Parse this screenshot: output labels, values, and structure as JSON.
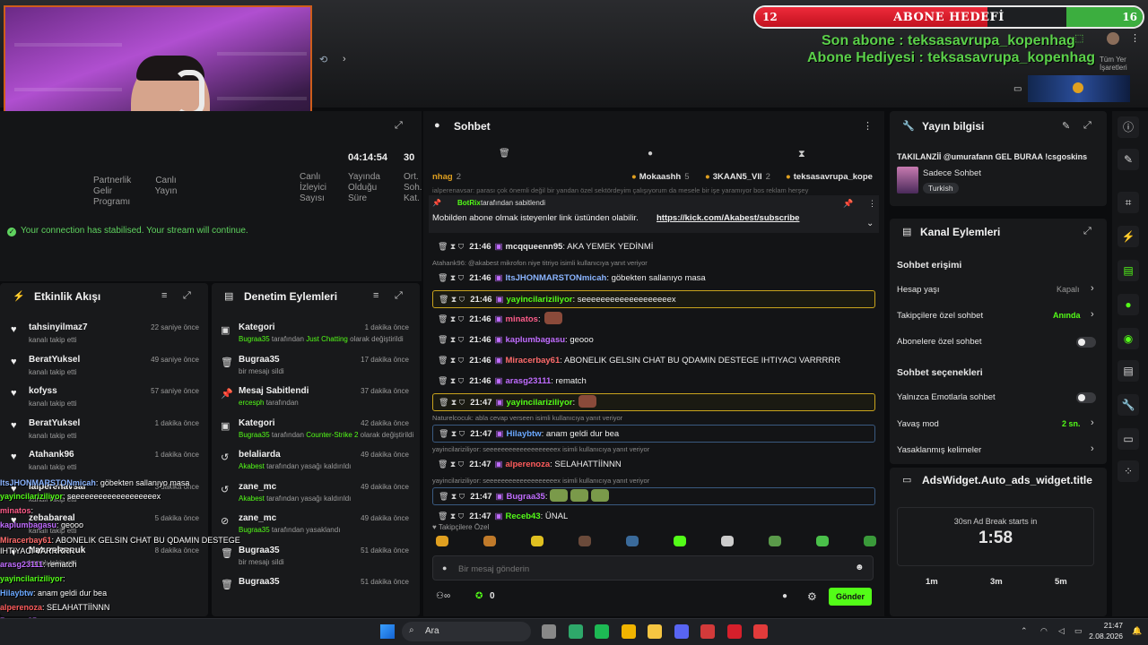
{
  "overlay": {
    "goal_title": "ABONE HEDEFİ",
    "goal_current": "12",
    "goal_target": "16",
    "goal_progress": 0.75,
    "last_sub": "Son abone : teksasavrupa_kopenhag",
    "gift_sub": "Abone Hediyesi : teksasavrupa_kopenhag",
    "bookmarks": "Tüm Yer İşaretleri",
    "chat_lines": [
      {
        "user": "ItsJHONMARSTONmicah",
        "text": ": göbekten sallanıyo masa"
      },
      {
        "user": "yayincilariziliyor",
        "text": ": seeeeeeeeeeeeeeeeeeex"
      },
      {
        "user": "minatos",
        "text": ":"
      },
      {
        "user": "kaplumbagasu",
        "text": ": geooo"
      },
      {
        "user": "Miracerbay61",
        "text": ": ABONELIK GELSIN CHAT BU QDAMIN DESTEGE IHTIYACI VARRRRR"
      },
      {
        "user": "arasg23111",
        "text": ": rematch"
      },
      {
        "user": "yayincilariziliyor",
        "text": ":"
      },
      {
        "user": "Hilaybtw",
        "text": ": anam geldi dur bea"
      },
      {
        "user": "alperenoza",
        "text": ": SELAHATTİİNNN"
      },
      {
        "user": "Bugraa35",
        "text": ":"
      },
      {
        "user": "Receb43",
        "text": ": ÜNAL"
      }
    ]
  },
  "stats": {
    "partner_label": "Partnerlik Gelir Programı",
    "live_label": "Canlı Yayın",
    "time_value": "04:14:54",
    "time_label": "Yayında Olduğu Süre",
    "extra_value": "30",
    "extra_label": "Ort. Soh. Kat.",
    "viewers_label": "Canlı İzleyici Sayısı",
    "connection": "Your connection has stabilised. Your stream will continue."
  },
  "activity": {
    "title": "Etkinlik Akışı",
    "items": [
      {
        "user": "tahsinyilmaz7",
        "sub": "kanalı takip etti",
        "time": "22 saniye önce"
      },
      {
        "user": "BeratYuksel",
        "sub": "kanalı takip etti",
        "time": "49 saniye önce"
      },
      {
        "user": "kofyss",
        "sub": "kanalı takip etti",
        "time": "57 saniye önce"
      },
      {
        "user": "BeratYuksel",
        "sub": "kanalı takip etti",
        "time": "1 dakika önce"
      },
      {
        "user": "Atahank96",
        "sub": "kanalı takip etti",
        "time": "1 dakika önce"
      },
      {
        "user": "ialperenavsar",
        "sub": "kanalı takip etti",
        "time": "3 dakika önce"
      },
      {
        "user": "zebabareal",
        "sub": "kanalı takip etti",
        "time": "5 dakika önce"
      },
      {
        "user": "Naturelcocuk",
        "sub": "kanalı takip etti",
        "time": "8 dakika önce"
      }
    ]
  },
  "moderation": {
    "title": "Denetim Eylemleri",
    "items": [
      {
        "title": "Kategori",
        "actor": "Bugraa35",
        "mid": " tarafından ",
        "target": "Just Chatting",
        "end": " olarak değiştirildi",
        "time": "1 dakika önce"
      },
      {
        "title": "Bugraa35",
        "actor": "",
        "mid": "bir mesajı sildi",
        "target": "",
        "end": "",
        "time": "17 dakika önce"
      },
      {
        "title": "Mesaj Sabitlendi",
        "actor": "ercesph",
        "mid": " tarafından",
        "target": "",
        "end": "",
        "time": "37 dakika önce"
      },
      {
        "title": "Kategori",
        "actor": "Bugraa35",
        "mid": " tarafından ",
        "target": "Counter-Strike 2",
        "end": " olarak değiştirildi",
        "time": "42 dakika önce"
      },
      {
        "title": "belaliarda",
        "actor": "Akabest",
        "mid": " tarafından yasağı kaldırıldı",
        "target": "",
        "end": "",
        "time": "49 dakika önce"
      },
      {
        "title": "zane_mc",
        "actor": "Akabest",
        "mid": " tarafından yasağı kaldırıldı",
        "target": "",
        "end": "",
        "time": "49 dakika önce"
      },
      {
        "title": "zane_mc",
        "actor": "Bugraa35",
        "mid": " tarafından yasaklandı",
        "target": "",
        "end": "",
        "time": "49 dakika önce"
      },
      {
        "title": "Bugraa35",
        "actor": "",
        "mid": "bir mesajı sildi",
        "target": "",
        "end": "",
        "time": "51 dakika önce"
      },
      {
        "title": "Bugraa35",
        "actor": "",
        "mid": "",
        "target": "",
        "end": "",
        "time": "51 dakika önce"
      }
    ]
  },
  "chat": {
    "title": "Sohbet",
    "top_users": [
      {
        "name": "nhag",
        "count": "2"
      },
      {
        "name": "Mokaashh",
        "count": "5"
      },
      {
        "name": "3KAAN5_VII",
        "count": "2"
      },
      {
        "name": "teksasavrupa_kope",
        "count": ""
      }
    ],
    "faded_line": "ialperenavsar: parası çok önemli değil bir yandan özel sektördeyim çalışıyorum da mesele bir işe yaramıyor bos reklam herşey",
    "pinned_by_user": "BotRix",
    "pinned_by_text": "tarafından sabitlendi",
    "pinned_text": "Mobilden abone olmak isteyenler link üstünden olabilir.",
    "pinned_link": "https://kick.com/Akabest/subscribe",
    "messages": [
      {
        "time": "21:46",
        "user": "mcqqueenn95",
        "text": ": AKA YEMEK YEDİNMİ",
        "reply": "",
        "color": "#e8e8e8"
      },
      {
        "time": "21:46",
        "user": "ItsJHONMARSTONmicah",
        "text": ": göbekten sallanıyo masa",
        "reply": "Atahank96: @akabest mikrofon niye titriyo isimli kullanıcıya yanıt veriyor",
        "color": "#8ab4ff"
      },
      {
        "time": "21:46",
        "user": "yayincilariziliyor",
        "text": ": seeeeeeeeeeeeeeeeeeex",
        "reply": "",
        "color": "#53fc18"
      },
      {
        "time": "21:46",
        "user": "minatos",
        "text": ":",
        "reply": "",
        "color": "#ff5c8a"
      },
      {
        "time": "21:46",
        "user": "kaplumbagasu",
        "text": ": geooo",
        "reply": "",
        "color": "#c06cff"
      },
      {
        "time": "21:46",
        "user": "Miracerbay61",
        "text": ": ABONELIK GELSIN CHAT BU QDAMIN DESTEGE IHTIYACI VARRRRR",
        "reply": "",
        "color": "#ff6b6b"
      },
      {
        "time": "21:46",
        "user": "arasg23111",
        "text": ": rematch",
        "reply": "",
        "color": "#c06cff"
      },
      {
        "time": "21:47",
        "user": "yayincilariziliyor",
        "text": ":",
        "reply": "",
        "color": "#53fc18"
      },
      {
        "time": "21:47",
        "user": "Hilaybtw",
        "text": ": anam geldi dur bea",
        "reply": "Naturelcocuk: abla cevap verseen isimli kullanıcıya yanıt veriyor",
        "color": "#6aa8ff"
      },
      {
        "time": "21:47",
        "user": "alperenoza",
        "text": ": SELAHATTİİNNN",
        "reply": "yayincilariziliyor: seeeeeeeeeeeeeeeeeeex isimli kullanıcıya yanıt veriyor",
        "color": "#ff5c5c"
      },
      {
        "time": "21:47",
        "user": "Bugraa35",
        "text": ":",
        "reply": "yayincilariziliyor: seeeeeeeeeeeeeeeeeeex isimli kullanıcıya yanıt veriyor",
        "color": "#c06cff"
      },
      {
        "time": "21:47",
        "user": "Receb43",
        "text": ": ÜNAL",
        "reply": "",
        "color": "#53fc18"
      }
    ],
    "followers_label": "Takipçilere Özel",
    "input_placeholder": "Bir mesaj gönderin",
    "points": "0",
    "send_label": "Gönder"
  },
  "stream_info": {
    "title": "Yayın bilgisi",
    "stream_title": "TAKILANZİİ @umurafann GEL BURAA !csgoskins",
    "mode": "Sadece Sohbet",
    "language": "Turkish"
  },
  "channel_actions": {
    "title": "Kanal Eylemleri",
    "chat_access": "Sohbet erişimi",
    "account_age_label": "Hesap yaşı",
    "account_age_value": "Kapalı",
    "followers_only_label": "Takipçilere özel sohbet",
    "followers_only_value": "Anında",
    "subs_only_label": "Abonelere özel sohbet",
    "chat_options": "Sohbet seçenekleri",
    "emote_only_label": "Yalnızca Emotlarla sohbet",
    "slow_mode_label": "Yavaş mod",
    "slow_mode_value": "2 sn.",
    "banned_words_label": "Yasaklanmış kelimeler"
  },
  "ads": {
    "title": "AdsWidget.Auto_ads_widget.title",
    "countdown_label": "30sn Ad Break starts in",
    "countdown": "1:58",
    "options": [
      "1m",
      "3m",
      "5m"
    ]
  },
  "taskbar": {
    "search": "Ara",
    "time": "21:47",
    "date": "2.08.2026"
  }
}
